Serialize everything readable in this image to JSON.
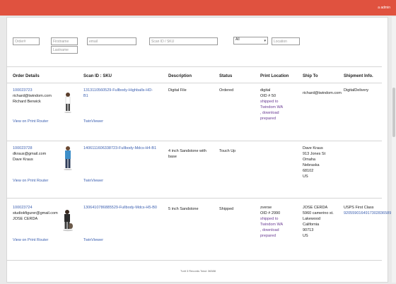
{
  "topbar": {
    "user_label": "a       admin"
  },
  "filters": {
    "orderid_placeholder": "Order#",
    "firstname_placeholder": "Firstname",
    "lastname_placeholder": "Lastname",
    "email_placeholder": "email",
    "scanid_placeholder": "Scan ID / SKU",
    "status_selected": "All",
    "location_placeholder": "Location"
  },
  "table": {
    "headers": [
      "Order Details",
      "Scan ID : SKU",
      "Description",
      "Status",
      "Print Location",
      "Ship To",
      "Shipment Info."
    ],
    "rows": [
      {
        "order_id": "100023723",
        "email": "richard@twindom.com",
        "name": "Richard Berwick",
        "view_link": "View on Print Router",
        "sku": "1313110560529-Fullbody-Highballs-HD-B1",
        "twinviewer": "TwinViewer",
        "description": "Digital File",
        "status": "Ordered",
        "print_location": [
          "digital",
          "OID # 50",
          "shipped to",
          "Twindom WA",
          ", download",
          "prepared"
        ],
        "ship_to": [
          "richard@twindom.com"
        ],
        "shipment_info": [
          "DigitalDelivery"
        ]
      },
      {
        "order_id": "100023728",
        "email": "dkraus@gmail.com",
        "name": "Dave Kraus",
        "view_link": "View on Print Router",
        "sku": "1406111606338723-Fullbody-Mdcs-H4-B1",
        "twinviewer": "TwinViewer",
        "description": "4 inch Sandstone with base",
        "status": "Touch Up",
        "print_location": [],
        "ship_to": [
          "Dave Kraus",
          "913 Jones St",
          "Omaha",
          "Nebraska",
          "68102",
          "US"
        ],
        "shipment_info": []
      },
      {
        "order_id": "100023724",
        "email": "studiokfigurer@gmail.com",
        "name": "JOSE CERDA",
        "view_link": "View on Print Router",
        "sku": "1306410786885529-Fullbody-Mdcs-H5-B0",
        "twinviewer": "TwinViewer",
        "description": "5 inch Sandstone",
        "status": "Shipped",
        "print_location": [
          "zverse",
          "OID # 2990",
          "shipped to",
          "Twindom WA",
          ", download",
          "prepared"
        ],
        "ship_to": [
          "JOSE CERDA",
          "5960 camerino st.",
          "Lakewood",
          "California",
          "90713",
          "US"
        ],
        "shipment_info": [
          "USPS First Class",
          "9205590164917302836589"
        ]
      }
    ]
  },
  "footer": {
    "text": "Tvdt 3 Records Total: 36388"
  }
}
